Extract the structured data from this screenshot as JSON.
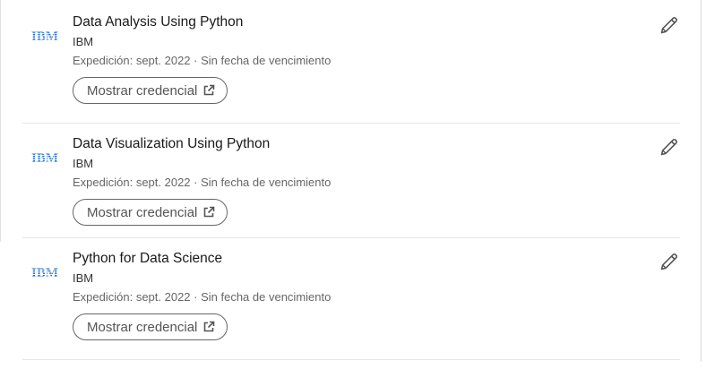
{
  "colors": {
    "ibm_blue": "#1f70c1",
    "text_primary": "#191919",
    "text_secondary": "#666666",
    "button_border": "#666666"
  },
  "certifications": [
    {
      "logo_icon": "ibm-logo-icon",
      "logo_text": "IBM",
      "title": "Data Analysis Using Python",
      "issuer": "IBM",
      "meta": "Expedición: sept. 2022 · Sin fecha de vencimiento",
      "credential_button": "Mostrar credencial",
      "external_icon": "external-link-icon",
      "edit_icon": "pencil-icon"
    },
    {
      "logo_icon": "ibm-logo-icon",
      "logo_text": "IBM",
      "title": "Data Visualization Using Python",
      "issuer": "IBM",
      "meta": "Expedición: sept. 2022 · Sin fecha de vencimiento",
      "credential_button": "Mostrar credencial",
      "external_icon": "external-link-icon",
      "edit_icon": "pencil-icon"
    },
    {
      "logo_icon": "ibm-logo-icon",
      "logo_text": "IBM",
      "title": "Python for Data Science",
      "issuer": "IBM",
      "meta": "Expedición: sept. 2022 · Sin fecha de vencimiento",
      "credential_button": "Mostrar credencial",
      "external_icon": "external-link-icon",
      "edit_icon": "pencil-icon"
    }
  ]
}
